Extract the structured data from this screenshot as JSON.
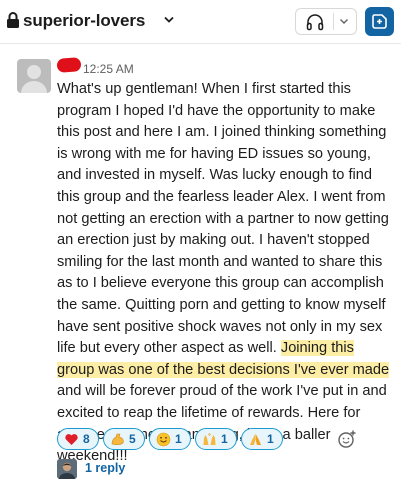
{
  "header": {
    "channel_name": "superior-lovers",
    "lock_icon": "lock-icon",
    "headphones_icon": "headphones-icon",
    "canvas_icon": "canvas-icon",
    "accent": "#1264a3"
  },
  "message": {
    "timestamp": "12:25 AM",
    "text_before_highlight": "What's up gentleman! When I first started this program I hoped I'd have the opportunity to make this post and here I am. I joined thinking something is wrong with me for having ED issues so young, and invested in myself. Was lucky enough to find this group and the fearless leader Alex. I went from not getting an erection with a partner to now getting an erection just by making out. I haven't stopped smiling for the last month and wanted to share this as to I believe everyone this group can accomplish the same. Quitting porn and getting to know myself have sent positive shock waves not only in my sex life but every other aspect as well. ",
    "highlighted_text": "Joining this group was one of the best decisions I've ever made",
    "text_after_highlight": " and will be forever proud of the work I've put in and excited to reap the lifetime of rewards. Here for anyone who needs anything, have a baller weekend!!!",
    "highlight_color": "#fdeea6"
  },
  "reactions": [
    {
      "icon": "heart",
      "count": "8"
    },
    {
      "icon": "flexed-biceps",
      "count": "5"
    },
    {
      "icon": "smiling-face",
      "count": "1"
    },
    {
      "icon": "raising-hands",
      "count": "1"
    },
    {
      "icon": "folded-hands",
      "count": "1"
    }
  ],
  "add_reaction_icon": "add-reaction-icon",
  "thread": {
    "reply_label": "1 reply"
  }
}
